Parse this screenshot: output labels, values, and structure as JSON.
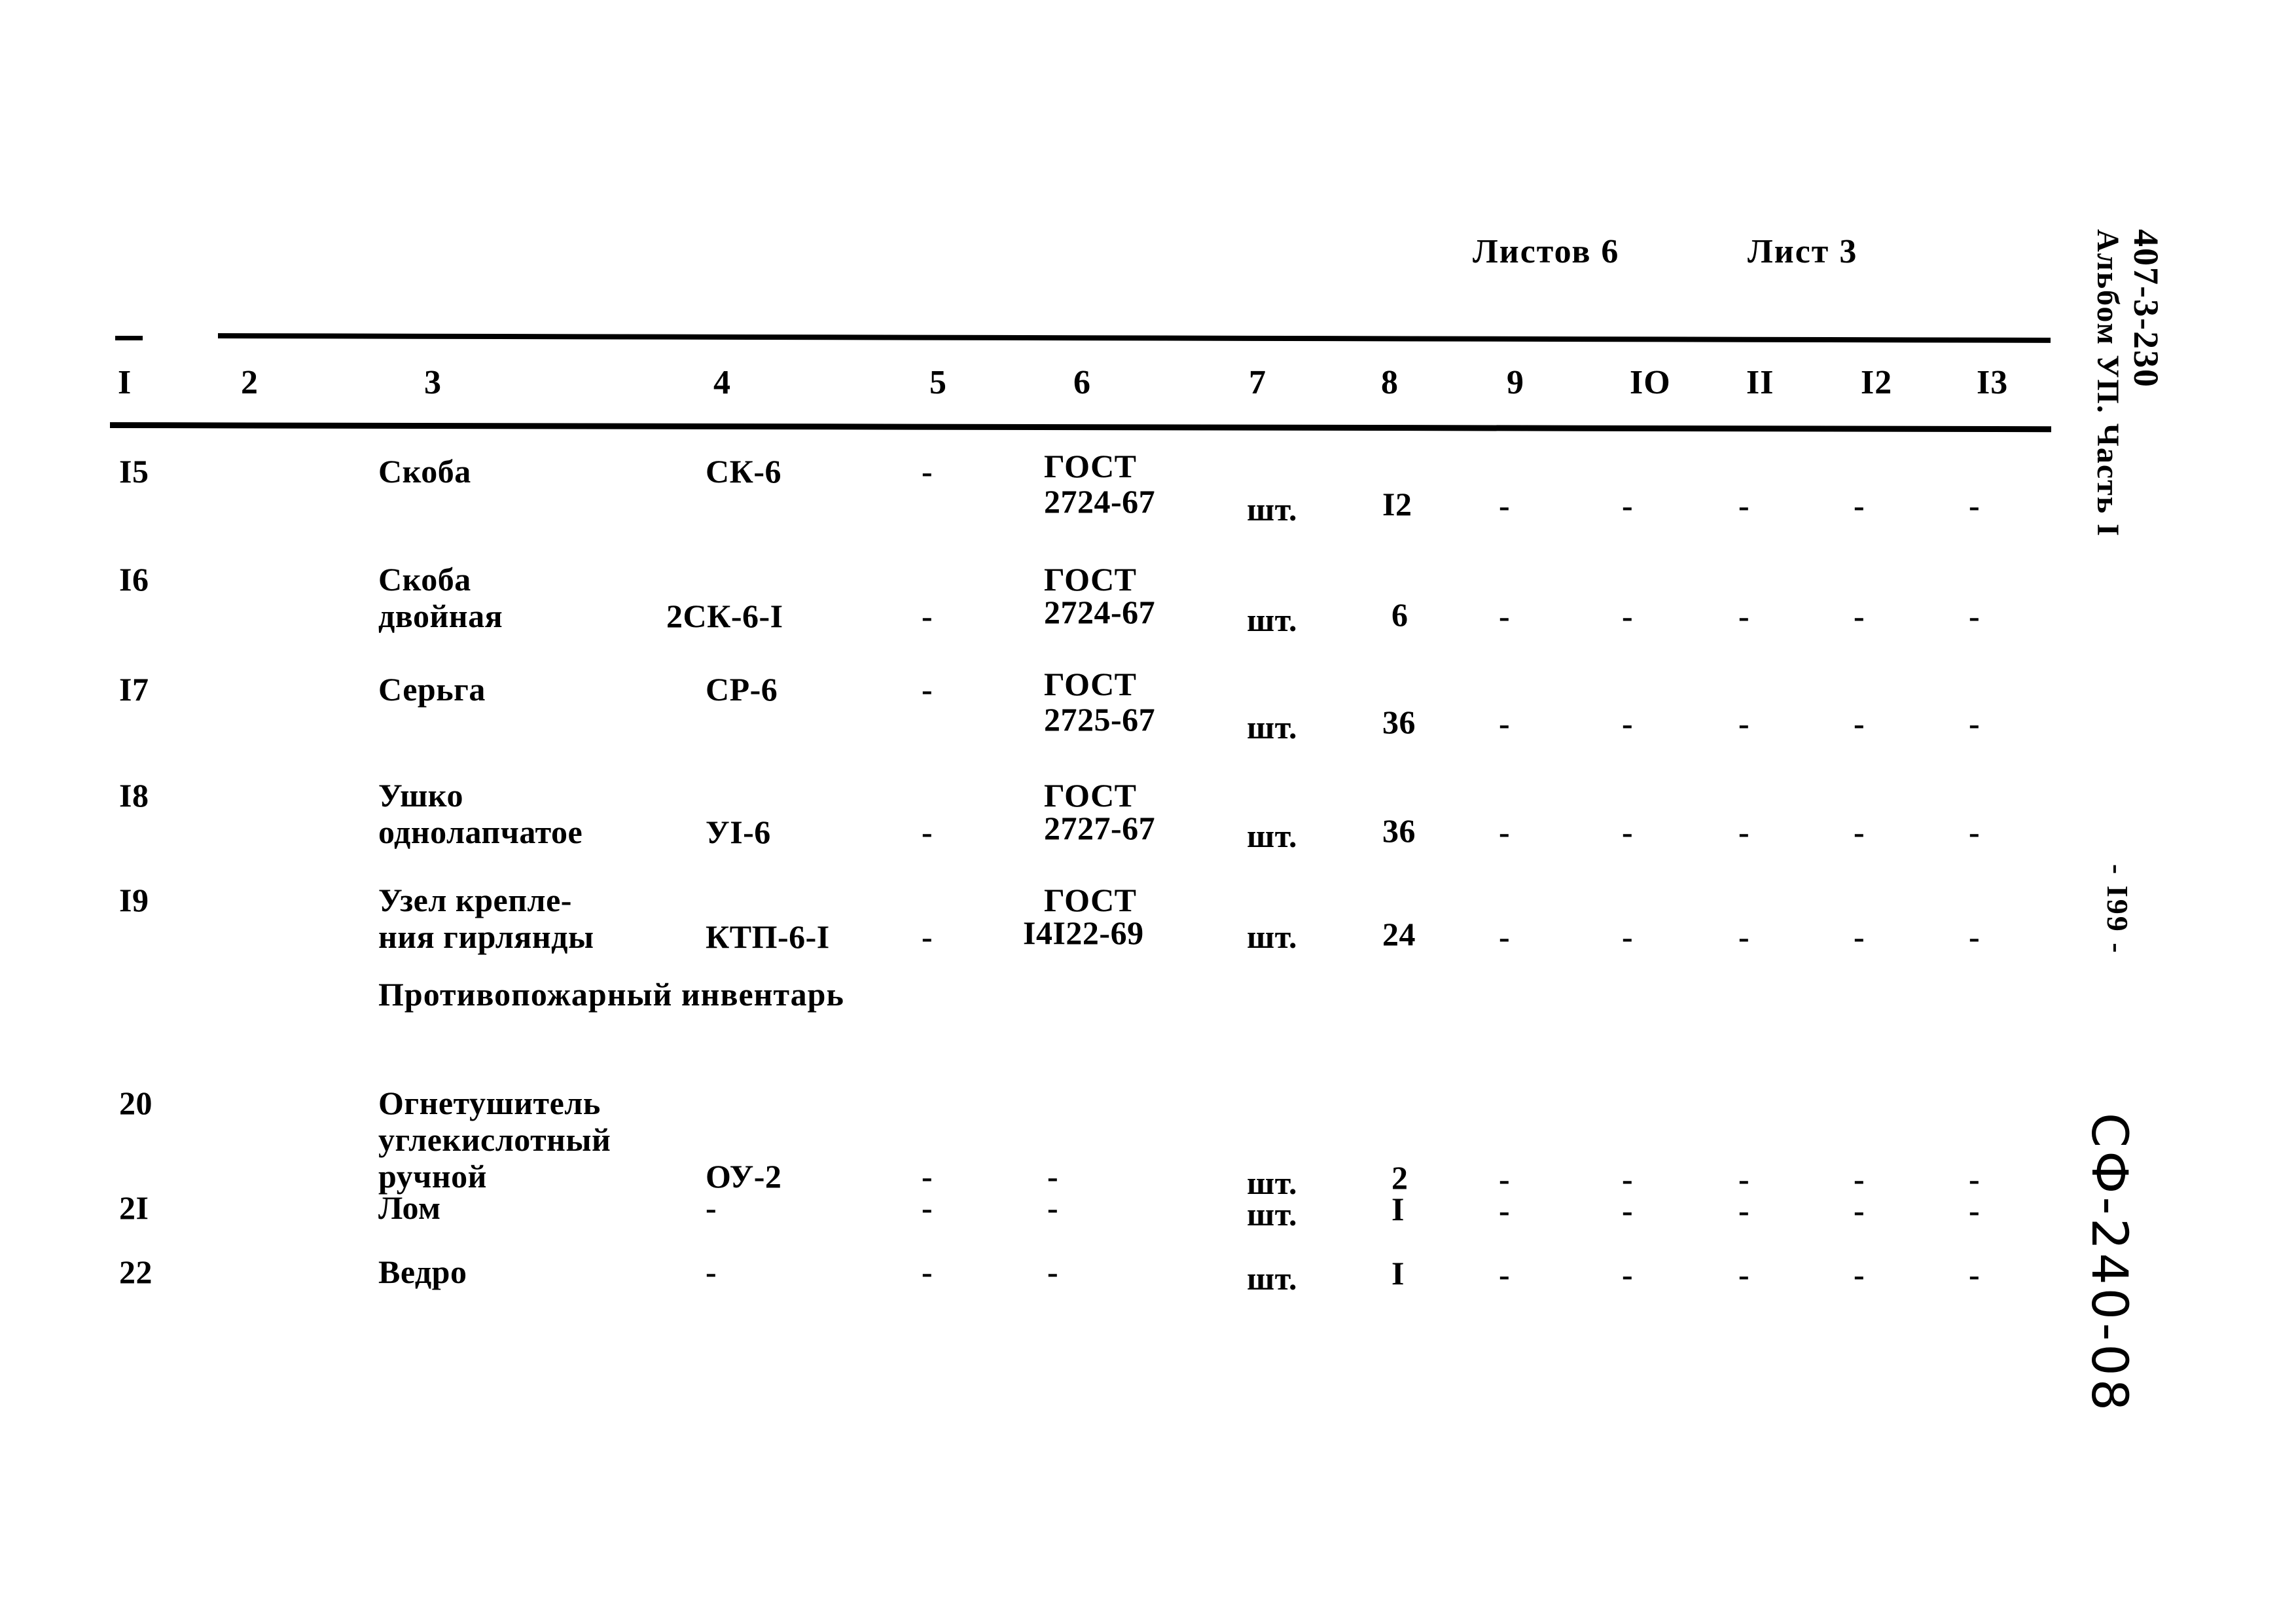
{
  "document": {
    "sheet_header": {
      "sheets_total_label": "Листов 6",
      "sheet_current_label": "Лист 3"
    },
    "margin": {
      "code_line1": "407-3-230",
      "code_line2": "Альбом УП. Часть I",
      "page_number": "- I99 -",
      "handwritten_stamp": "СФ-240-08"
    },
    "section_title": "Противопожарный инвентарь",
    "column_headers": [
      "I",
      "2",
      "3",
      "4",
      "5",
      "6",
      "7",
      "8",
      "9",
      "IO",
      "II",
      "I2",
      "I3"
    ],
    "rows": [
      {
        "no": "I5",
        "name_l1": "Скоба",
        "name_l2": "",
        "name_l3": "",
        "mark": "СК-6",
        "c5": "-",
        "std_l1": "ГОСТ",
        "std_l2": "2724-67",
        "unit": "шт.",
        "qty": "I2",
        "c9": "-",
        "c10": "-",
        "c11": "-",
        "c12": "-",
        "c13": "-"
      },
      {
        "no": "I6",
        "name_l1": "Скоба",
        "name_l2": "двойная",
        "name_l3": "",
        "mark": "2СК-6-I",
        "c5": "-",
        "std_l1": "ГОСТ",
        "std_l2": "2724-67",
        "unit": "шт.",
        "qty": "6",
        "c9": "-",
        "c10": "-",
        "c11": "-",
        "c12": "-",
        "c13": "-"
      },
      {
        "no": "I7",
        "name_l1": "Серьга",
        "name_l2": "",
        "name_l3": "",
        "mark": "СР-6",
        "c5": "-",
        "std_l1": "ГОСТ",
        "std_l2": "2725-67",
        "unit": "шт.",
        "qty": "36",
        "c9": "-",
        "c10": "-",
        "c11": "-",
        "c12": "-",
        "c13": "-"
      },
      {
        "no": "I8",
        "name_l1": "Ушко",
        "name_l2": "однолапчатое",
        "name_l3": "",
        "mark": "УI-6",
        "c5": "-",
        "std_l1": "ГОСТ",
        "std_l2": "2727-67",
        "unit": "шт.",
        "qty": "36",
        "c9": "-",
        "c10": "-",
        "c11": "-",
        "c12": "-",
        "c13": "-"
      },
      {
        "no": "I9",
        "name_l1": "Узел крепле-",
        "name_l2": "ния гирлянды",
        "name_l3": "",
        "mark": "КТП-6-I",
        "c5": "-",
        "std_l1": "ГОСТ",
        "std_l2": "I4I22-69",
        "unit": "шт.",
        "qty": "24",
        "c9": "-",
        "c10": "-",
        "c11": "-",
        "c12": "-",
        "c13": "-"
      },
      {
        "no": "20",
        "name_l1": "Огнетушитель",
        "name_l2": "углекислотный",
        "name_l3": "ручной",
        "mark": "ОУ-2",
        "c5": "-",
        "std_l1": "",
        "std_l2": "-",
        "unit": "шт.",
        "qty": "2",
        "c9": "-",
        "c10": "-",
        "c11": "-",
        "c12": "-",
        "c13": "-"
      },
      {
        "no": "2I",
        "name_l1": "Лом",
        "name_l2": "",
        "name_l3": "",
        "mark": "-",
        "c5": "-",
        "std_l1": "",
        "std_l2": "-",
        "unit": "шт.",
        "qty": "I",
        "c9": "-",
        "c10": "-",
        "c11": "-",
        "c12": "-",
        "c13": "-"
      },
      {
        "no": "22",
        "name_l1": "Ведро",
        "name_l2": "",
        "name_l3": "",
        "mark": "-",
        "c5": "-",
        "std_l1": "",
        "std_l2": "-",
        "unit": "шт.",
        "qty": "I",
        "c9": "-",
        "c10": "-",
        "c11": "-",
        "c12": "-",
        "c13": "-"
      }
    ]
  }
}
